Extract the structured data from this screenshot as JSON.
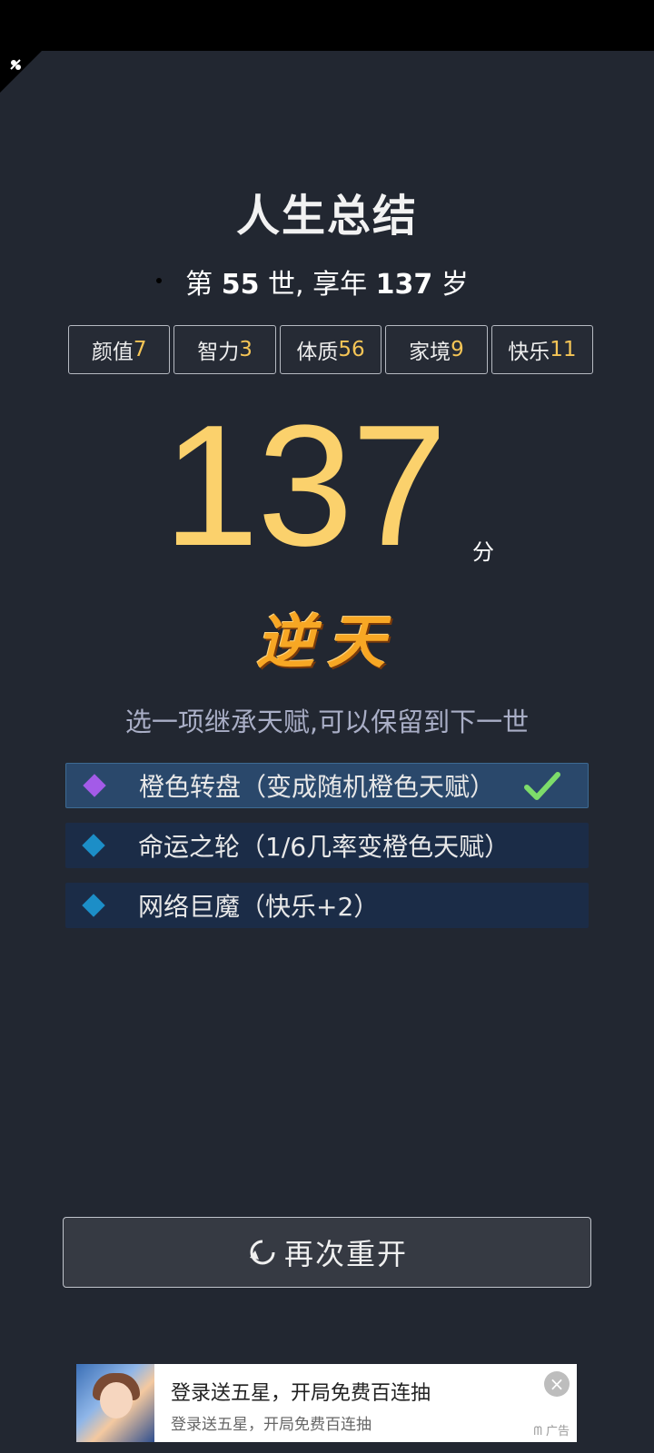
{
  "summary": {
    "title": "人生总结",
    "subtitle": {
      "prefix": "第",
      "generation": "55",
      "mid": "世, 享年",
      "age": "137",
      "suffix": "岁"
    }
  },
  "stats": [
    {
      "label": "颜值",
      "value": "7"
    },
    {
      "label": "智力",
      "value": "3"
    },
    {
      "label": "体质",
      "value": "56"
    },
    {
      "label": "家境",
      "value": "9"
    },
    {
      "label": "快乐",
      "value": "11"
    }
  ],
  "score": {
    "value": "137",
    "unit": "分"
  },
  "rank_title": "逆天",
  "inherit_tip": "选一项继承天赋,可以保留到下一世",
  "talents": [
    {
      "label": "橙色转盘（变成随机橙色天赋）",
      "selected": true,
      "gem_color": "#a35be8"
    },
    {
      "label": "命运之轮（1/6几率变橙色天赋）",
      "selected": false,
      "gem_color": "#1c8ec7"
    },
    {
      "label": "网络巨魔（快乐+2）",
      "selected": false,
      "gem_color": "#1c8ec7"
    }
  ],
  "restart_button": {
    "label": "再次重开",
    "icon": "refresh-icon"
  },
  "ad": {
    "title": "登录送五星，开局免费百连抽",
    "subtitle": "登录送五星，开局免费百连抽",
    "label": "广告",
    "close_icon": "close-icon"
  },
  "colors": {
    "background": "#222731",
    "accent_gold": "#fbd16c",
    "rank_orange": "#f7a724",
    "selected_row": "#2a486b"
  }
}
